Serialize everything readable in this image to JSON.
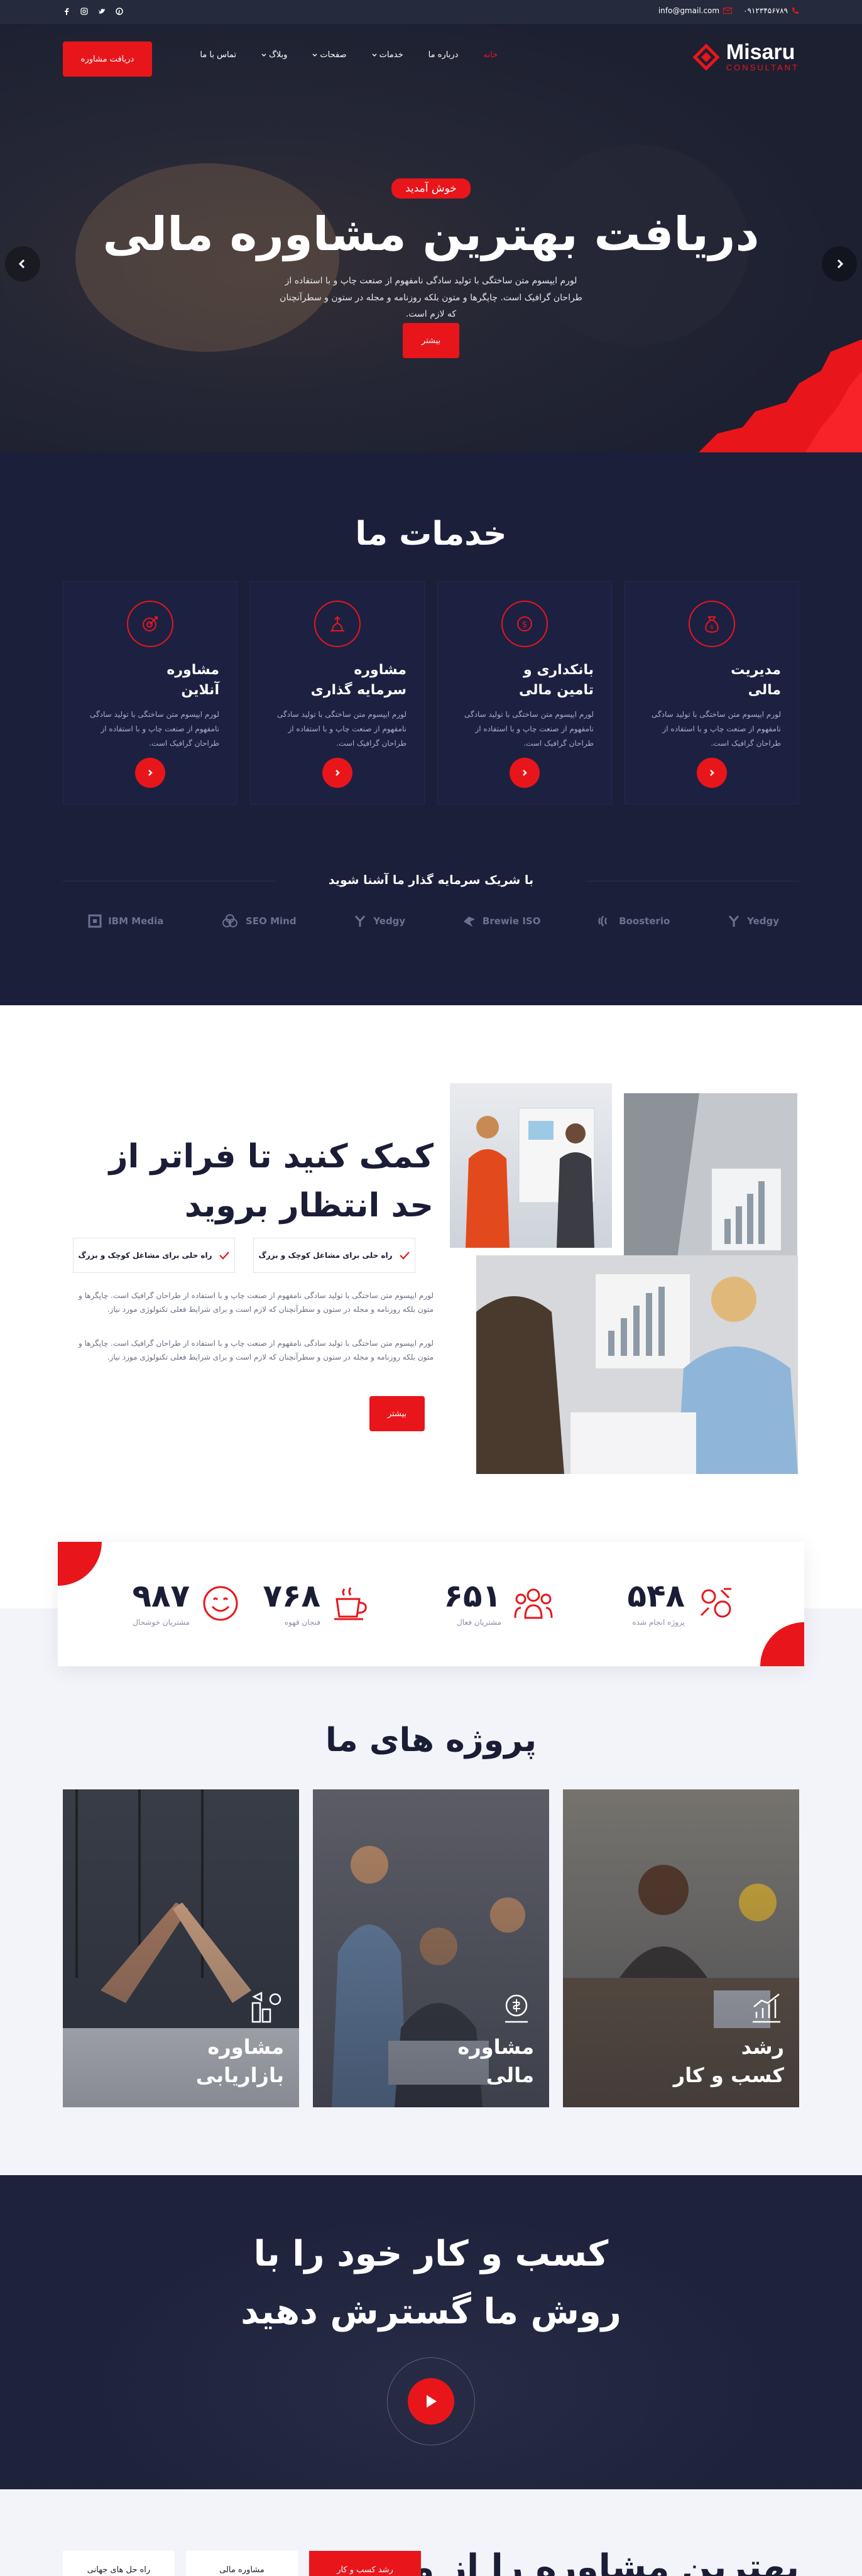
{
  "topbar": {
    "phone": "۰۹۱۲۳۴۵۶۷۸۹",
    "email": "info@gmail.com",
    "social": [
      "pinterest-icon",
      "twitter-icon",
      "instagram-icon",
      "facebook-icon"
    ]
  },
  "header": {
    "logo_name": "Misaru",
    "logo_sub": "CONSULTANT",
    "nav": [
      {
        "label": "خانه",
        "active": true
      },
      {
        "label": "درباره ما"
      },
      {
        "label": "خدمات"
      },
      {
        "label": "صفحات"
      },
      {
        "label": "وبلاگ"
      },
      {
        "label": "تماس با ما"
      }
    ],
    "cta": "دریافت مشاوره"
  },
  "hero": {
    "badge": "خوش آمدید",
    "title": "دریافت بهترین مشاوره مالی",
    "desc": "لورم ایپسوم متن ساختگی با تولید سادگی نامفهوم از صنعت چاپ و با استفاده از طراحان گرافیک است. چاپگرها و متون بلکه روزنامه و مجله در ستون و سطرآنچنان که لازم است.",
    "button": "بیشتر"
  },
  "services": {
    "title": "خدمات ما",
    "cards": [
      {
        "title": "مدیریت\nمالی",
        "text": "لورم ایپسوم متن ساختگی با تولید سادگی نامفهوم از صنعت چاپ و با استفاده از طراحان گرافیک است.",
        "icon": "money-bag-icon"
      },
      {
        "title": "بانکداری و\nتامین مالی",
        "text": "لورم ایپسوم متن ساختگی با تولید سادگی نامفهوم از صنعت چاپ و با استفاده از طراحان گرافیک است.",
        "icon": "bank-icon"
      },
      {
        "title": "مشاوره\nسرمایه گذاری",
        "text": "لورم ایپسوم متن ساختگی با تولید سادگی نامفهوم از صنعت چاپ و با استفاده از طراحان گرافیک است.",
        "icon": "investment-icon"
      },
      {
        "title": "مشاوره\nآنلاین",
        "text": "لورم ایپسوم متن ساختگی با تولید سادگی نامفهوم از صنعت چاپ و با استفاده از طراحان گرافیک است.",
        "icon": "target-icon"
      }
    ],
    "partners_title": "با شریک سرمایه گذار ما آشنا شوید",
    "partners": [
      "Yedgy",
      "Boosterio",
      "Brewie ISO",
      "Yedgy",
      "SEO Mind",
      "IBM Media"
    ]
  },
  "about": {
    "title": "کمک کنید تا فراتر از حد انتظار بروید",
    "features": [
      "راه حلی برای مشاغل کوچک و بزرگ",
      "راه حلی برای مشاغل کوچک و بزرگ"
    ],
    "p1": "لورم ایپسوم متن ساختگی با تولید سادگی نامفهوم از صنعت چاپ و با استفاده از طراحان گرافیک است. چاپگرها و متون بلکه روزنامه و مجله در ستون و سطرآنچنان که لازم است و برای شرایط فعلی تکنولوژی مورد نیاز.",
    "p2": "لورم ایپسوم متن ساختگی با تولید سادگی نامفهوم از صنعت چاپ و با استفاده از طراحان گرافیک است. چاپگرها و متون بلکه روزنامه و مجله در ستون و سطرآنچنان که لازم است و برای شرایط فعلی تکنولوژی مورد نیاز.",
    "button": "بیشتر"
  },
  "stats": [
    {
      "num": "۵۴۸",
      "label": "پروژه انجام شده",
      "icon": "project-icon"
    },
    {
      "num": "۶۵۱",
      "label": "مشتریان فعال",
      "icon": "team-icon"
    },
    {
      "num": "۷۶۸",
      "label": "فنجان قهوه",
      "icon": "coffee-icon"
    },
    {
      "num": "۹۸۷",
      "label": "مشتریان خوشحال",
      "icon": "smile-icon"
    }
  ],
  "projects": {
    "title": "پروژه های ما",
    "items": [
      {
        "name": "رشد\nکسب و کار",
        "icon": "growth-chart-icon"
      },
      {
        "name": "مشاوره\nمالی",
        "icon": "finance-icon"
      },
      {
        "name": "مشاوره\nبازاریابی",
        "icon": "marketing-icon"
      }
    ]
  },
  "video": {
    "title": "کسب و کار خود را با\nروش ما گسترش دهید"
  },
  "bottom": {
    "title": "بهترین مشاوره را از ما",
    "tabs": [
      "راه حل های جهانی",
      "مشاوره مالی",
      "رشد کسب و کار"
    ],
    "active_tab": 2
  },
  "colors": {
    "accent": "#e8161b",
    "dark": "#1b1f3a"
  }
}
